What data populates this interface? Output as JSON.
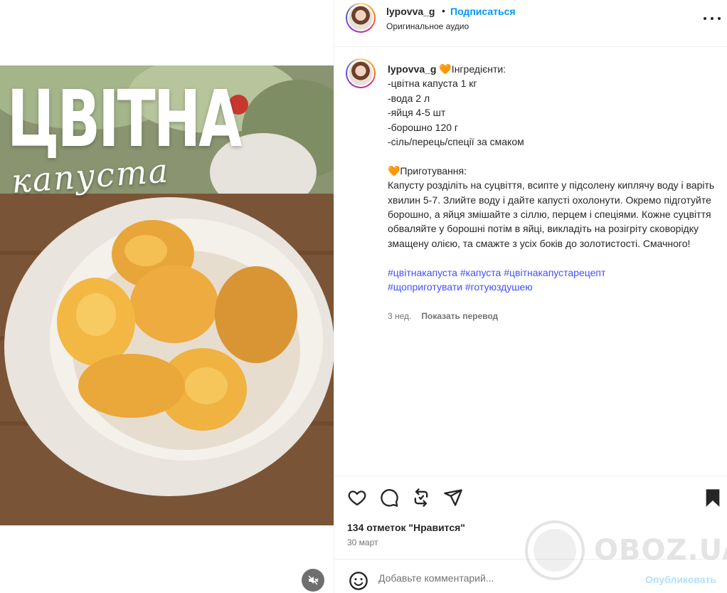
{
  "post": {
    "username": "lypovva_g",
    "dot": "•",
    "follow_label": "Подписаться",
    "audio_label": "Оригинальное аудио"
  },
  "media": {
    "title_text": "ЦВІТНА",
    "subtitle_text": "капуста"
  },
  "caption": {
    "username": "lypovva_g",
    "lines": [
      "🧡Інгредієнти:",
      "-цвітна капуста 1 кг",
      "-вода 2 л",
      "-яйця 4-5 шт",
      "-борошно 120 г",
      "-сіль/перець/спеції за смаком",
      "",
      "🧡Приготування:",
      "Капусту розділіть на суцвіття, всипте у підсолену киплячу воду і варіть хвилин 5-7. Злийте воду і дайте капусті охолонути. Окремо підготуйте борошно, а яйця змішайте з сіллю, перцем і спеціями. Кожне суцвіття обваляйте у борошні потім в яйці, викладіть на розігріту сковорідку змащену олією, та смажте з усіх боків до золотистості. Смачного!",
      ""
    ],
    "hashtags_line1": "#цвітнакапуста #капуста #цвітнакапустарецепт",
    "hashtags_line2": "#щоприготувати #готуюздушею",
    "time_ago": "3 нед.",
    "translate_label": "Показать перевод"
  },
  "actions": {
    "icons": [
      "heart-icon",
      "comment-icon",
      "repost-icon",
      "share-icon",
      "bookmark-icon"
    ],
    "likes_text": "134 отметок \"Нравится\"",
    "date_text": "30 март"
  },
  "comment": {
    "placeholder": "Добавьте комментарий...",
    "publish_label": "Опубликовать"
  },
  "watermark": {
    "text": "OBOZ.UA"
  },
  "colors": {
    "link_blue": "#0095f6",
    "hashtag_blue": "#4150f7",
    "muted_text": "#737373",
    "border": "#efefef"
  }
}
